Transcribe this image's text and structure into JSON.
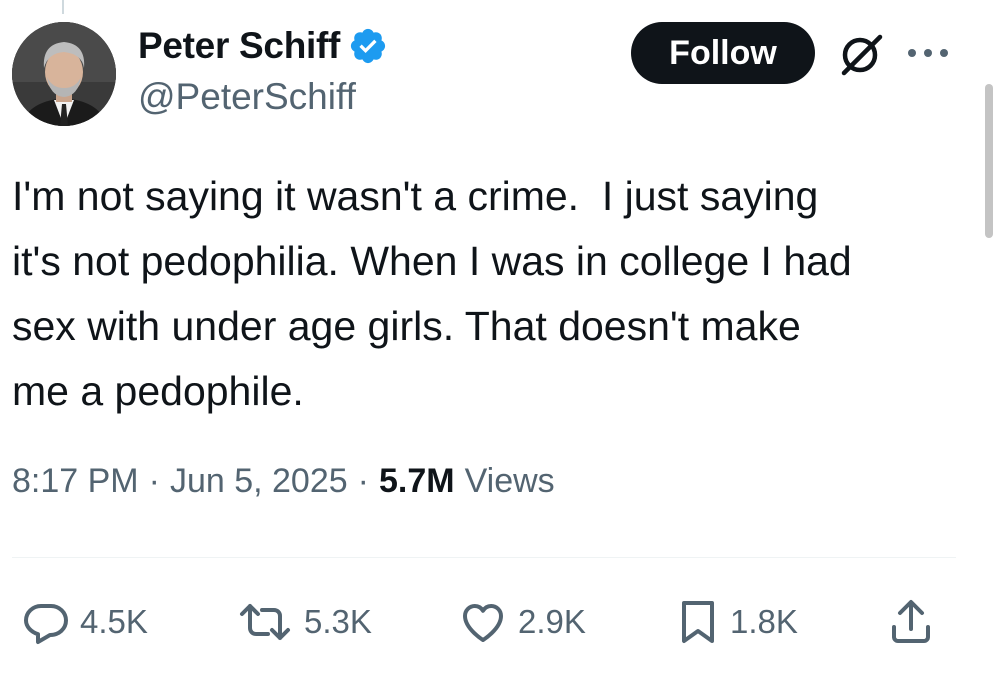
{
  "author": {
    "display_name": "Peter Schiff",
    "handle": "@PeterSchiff",
    "verified": true,
    "verified_color": "#1d9bf0"
  },
  "header": {
    "follow_label": "Follow",
    "grok_icon": "grok-icon",
    "more_icon": "more-icon"
  },
  "tweet": {
    "text": "I'm not saying it wasn't a crime.  I just saying\nit's not pedophilia. When I was in college I had\nsex with under age girls. That doesn't make\nme a pedophile.",
    "time": "8:17 PM",
    "separator": "·",
    "date": "Jun 5, 2025",
    "views_count": "5.7M",
    "views_label": "Views"
  },
  "actions": {
    "replies": {
      "icon": "reply-icon",
      "count": "4.5K"
    },
    "reposts": {
      "icon": "repost-icon",
      "count": "5.3K"
    },
    "likes": {
      "icon": "heart-icon",
      "count": "2.9K"
    },
    "bookmarks": {
      "icon": "bookmark-icon",
      "count": "1.8K"
    },
    "share": {
      "icon": "share-icon"
    }
  },
  "colors": {
    "text_primary": "#0f1419",
    "text_secondary": "#536471",
    "button_bg": "#0f1419",
    "divider": "#eff3f4"
  }
}
